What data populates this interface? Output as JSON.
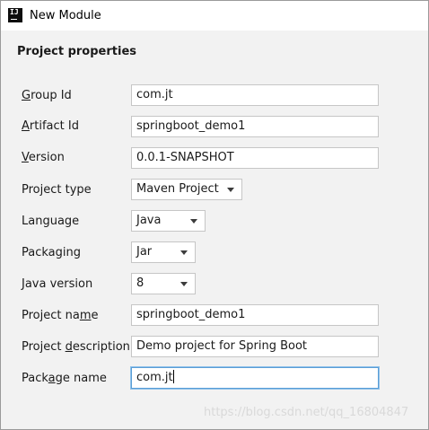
{
  "window": {
    "title": "New Module",
    "icon": "intellij-icon",
    "icon_text": "IJ"
  },
  "section": {
    "title": "Project properties"
  },
  "fields": {
    "group_id": {
      "label": "Group Id",
      "mnemonic_index": 0,
      "value": "com.jt"
    },
    "artifact_id": {
      "label": "Artifact Id",
      "mnemonic_index": 0,
      "value": "springboot_demo1"
    },
    "version": {
      "label": "Version",
      "mnemonic_index": 0,
      "value": "0.0.1-SNAPSHOT"
    },
    "project_type": {
      "label": "Project type",
      "value": "Maven Project"
    },
    "language": {
      "label": "Language",
      "value": "Java"
    },
    "packaging": {
      "label": "Packaging",
      "value": "Jar"
    },
    "java_version": {
      "label": "Java version",
      "value": "8"
    },
    "project_name": {
      "label": "Project name",
      "mnemonic_index": 10,
      "value": "springboot_demo1"
    },
    "project_description": {
      "label": "Project description",
      "mnemonic_index": 8,
      "value": "Demo project for Spring Boot"
    },
    "package_name": {
      "label": "Package name",
      "mnemonic_index": 4,
      "value": "com.jt"
    }
  },
  "focused_field": "package_name",
  "watermark": "https://blog.csdn.net/qq_16804847",
  "colors": {
    "background": "#f2f2f2",
    "titlebar": "#ffffff",
    "focus": "#5a9ed6",
    "field_border": "#c6c6c6"
  }
}
